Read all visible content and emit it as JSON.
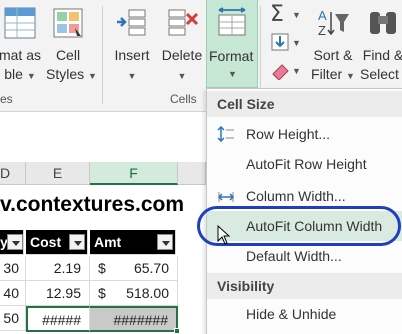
{
  "ribbon": {
    "partial_left_line1": "mat as",
    "partial_left_line2": "ble",
    "partial_group_left": "es",
    "cell_styles_line1": "Cell",
    "cell_styles_line2": "Styles",
    "insert": "Insert",
    "delete": "Delete",
    "format": "Format",
    "cells_group": "Cells",
    "sort_line1": "Sort &",
    "sort_line2": "Filter",
    "find_line1": "Find &",
    "find_line2": "Select",
    "sigma_icon": "autosum-icon",
    "accent_color": "#217346"
  },
  "grid": {
    "col_partial": "D",
    "col_e": "E",
    "col_f": "F",
    "site_text": "v.contextures.com",
    "hdr_partial": "y",
    "hdr_cost": "Cost",
    "hdr_amt": "Amt",
    "rows": [
      {
        "qty": "30",
        "cost": "2.19",
        "cur": "$",
        "amt": "65.70"
      },
      {
        "qty": "40",
        "cost": "12.95",
        "cur": "$",
        "amt": "518.00"
      },
      {
        "qty": "50",
        "cost": "#####",
        "cur": "",
        "amt": "#######"
      }
    ]
  },
  "menu": {
    "section_cell_size": "Cell Size",
    "row_height": "Row Height...",
    "autofit_row": "AutoFit Row Height",
    "column_width": "Column Width...",
    "autofit_col": "AutoFit Column Width",
    "default_width": "Default Width...",
    "section_visibility": "Visibility",
    "hide_unhide": "Hide & Unhide",
    "highlight_ring_color": "#1f3fbf"
  }
}
